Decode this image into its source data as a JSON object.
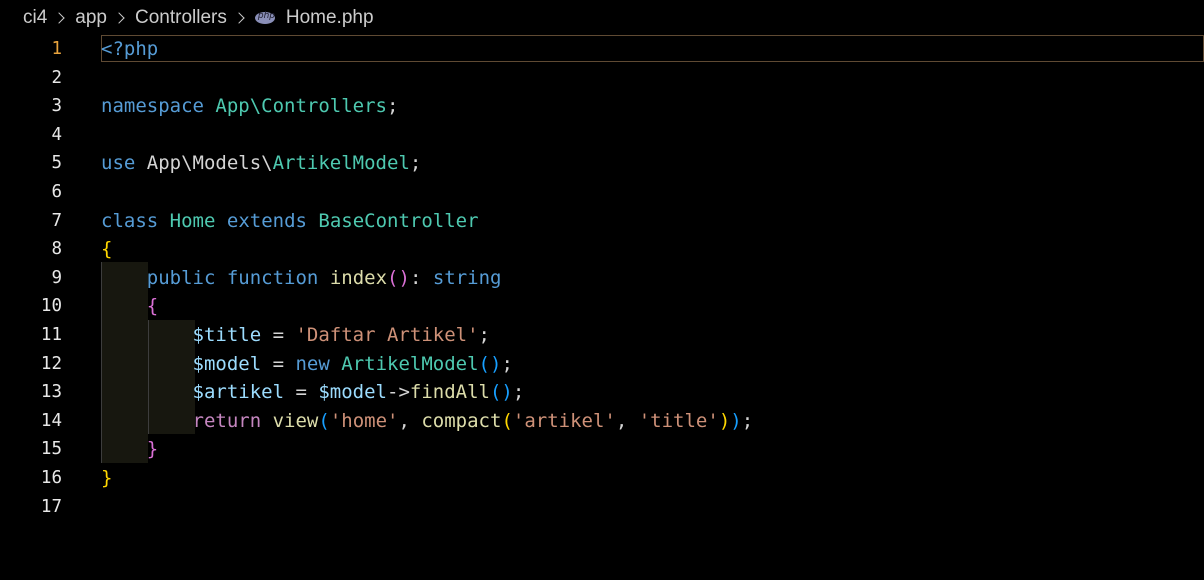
{
  "breadcrumb": {
    "items": [
      "ci4",
      "app",
      "Controllers"
    ],
    "file": "Home.php",
    "file_icon": "php-icon"
  },
  "editor": {
    "active_line": 1,
    "line_numbers": [
      "1",
      "2",
      "3",
      "4",
      "5",
      "6",
      "7",
      "8",
      "9",
      "10",
      "11",
      "12",
      "13",
      "14",
      "15",
      "16",
      "17"
    ],
    "lines": {
      "l1": [
        "<?php"
      ],
      "l3": [
        "namespace",
        " ",
        "App\\Controllers",
        ";"
      ],
      "l5": [
        "use",
        " App\\Models\\",
        "ArtikelModel",
        ";"
      ],
      "l7": [
        "class",
        " ",
        "Home",
        " ",
        "extends",
        " ",
        "BaseController"
      ],
      "l8": [
        "{"
      ],
      "l9": [
        "    ",
        "public",
        " ",
        "function",
        " ",
        "index",
        "(",
        ")",
        ": ",
        "string"
      ],
      "l10": [
        "    ",
        "{"
      ],
      "l11": [
        "        ",
        "$title",
        " = ",
        "'Daftar Artikel'",
        ";"
      ],
      "l12": [
        "        ",
        "$model",
        " = ",
        "new",
        " ",
        "ArtikelModel",
        "(",
        ")",
        ";"
      ],
      "l13": [
        "        ",
        "$artikel",
        " = ",
        "$model",
        "->",
        "findAll",
        "(",
        ")",
        ";"
      ],
      "l14": [
        "        ",
        "return",
        " ",
        "view",
        "(",
        "'home'",
        ", ",
        "compact",
        "(",
        "'artikel'",
        ", ",
        "'title'",
        ")",
        ")",
        ";"
      ],
      "l15": [
        "    ",
        "}"
      ],
      "l16": [
        "}"
      ]
    }
  },
  "colors": {
    "background": "#000000",
    "keyword": "#569cd6",
    "type": "#4ec9b0",
    "variable": "#9cdcfe",
    "string": "#ce9178",
    "function": "#dcdcaa",
    "control": "#c586c0",
    "bracket_level1": "#ffd700",
    "bracket_level2": "#da70d6",
    "bracket_level3": "#179fff",
    "active_line_number": "#e8a33d",
    "active_line_border": "#5f4a33"
  }
}
